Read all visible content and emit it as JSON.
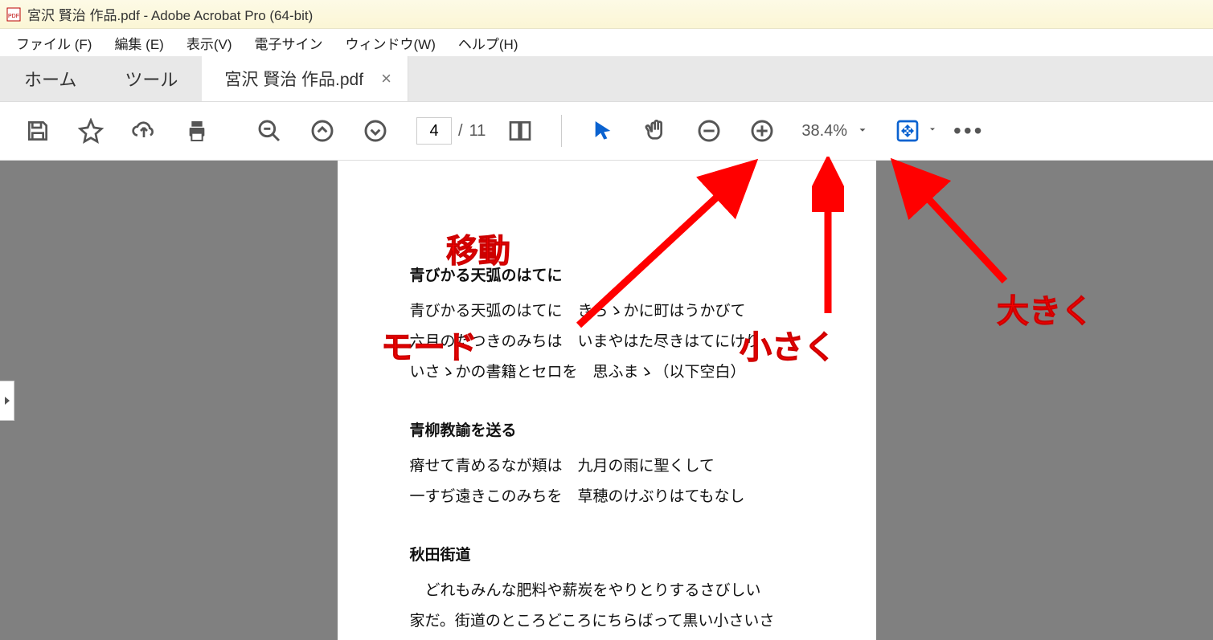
{
  "titlebar": {
    "title": "宮沢 賢治 作品.pdf - Adobe Acrobat Pro (64-bit)"
  },
  "menubar": {
    "file": "ファイル (F)",
    "edit": "編集 (E)",
    "view": "表示(V)",
    "esign": "電子サイン",
    "window": "ウィンドウ(W)",
    "help": "ヘルプ(H)"
  },
  "tabs": {
    "home": "ホーム",
    "tools": "ツール",
    "doc": "宮沢 賢治 作品.pdf",
    "close": "×"
  },
  "toolbar": {
    "page_current": "4",
    "page_sep": "/",
    "page_total": "11",
    "zoom_value": "38.4%"
  },
  "document": {
    "block1": {
      "title": "青びかる天弧のはてに",
      "l1": "青びかる天弧のはてに　きらゝかに町はうかびて",
      "l2": "六月のたつきのみちは　いまやはた尽きはてにけり",
      "l3": "いさゝかの書籍とセロを　思ふまゝ（以下空白）"
    },
    "block2": {
      "title": "青柳教諭を送る",
      "l1": "瘠せて青めるなが頬は　九月の雨に聖くして",
      "l2": "一すぢ遠きこのみちを　草穂のけぶりはてもなし"
    },
    "block3": {
      "title": "秋田街道",
      "l1": "どれもみんな肥料や薪炭をやりとりするさびしい",
      "l2": "家だ。街道のところどころにちらばって黒い小さいさ"
    }
  },
  "annotations": {
    "a1_l1": "移動",
    "a1_l2": "モード",
    "a2": "小さく",
    "a3": "大きく"
  }
}
